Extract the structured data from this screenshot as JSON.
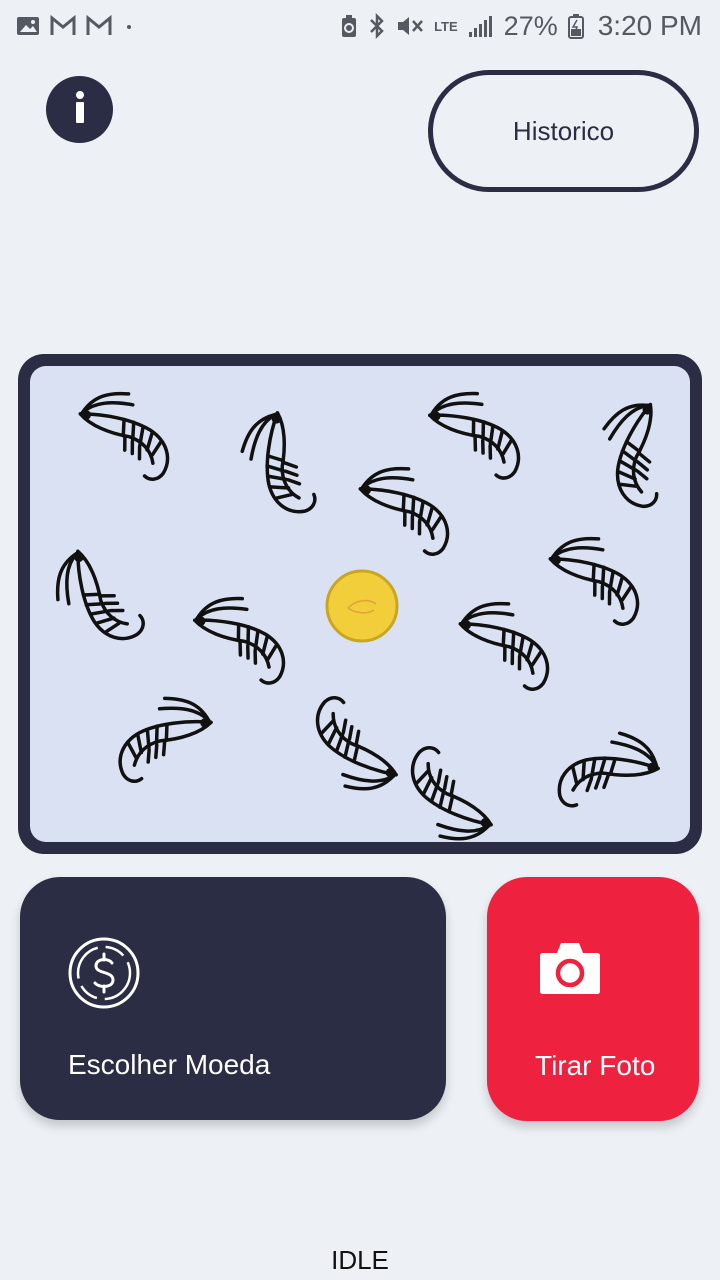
{
  "status_bar": {
    "battery": "27%",
    "time": "3:20 PM",
    "network_type": "LTE",
    "icons": [
      "image-icon",
      "gmail-icon",
      "gmail-icon",
      "dot-icon",
      "battery-saver-icon",
      "bluetooth-icon",
      "mute-icon",
      "lte-icon",
      "signal-icon",
      "battery-icon"
    ]
  },
  "header": {
    "info_icon": "info-icon",
    "history_label": "Historico"
  },
  "preview": {
    "background": "image of shrimp drawings with a gold coin in the center"
  },
  "actions": {
    "choose_coin_label": "Escolher Moeda",
    "choose_coin_icon": "dollar-coin-icon",
    "take_photo_label": "Tirar Foto",
    "take_photo_icon": "camera-icon"
  },
  "status": {
    "state": "IDLE"
  },
  "colors": {
    "background": "#edf1f5",
    "dark": "#2a2d43",
    "accent": "#ee213f",
    "preview_bg": "#d9e1f2",
    "coin": "#f2cf3a"
  }
}
